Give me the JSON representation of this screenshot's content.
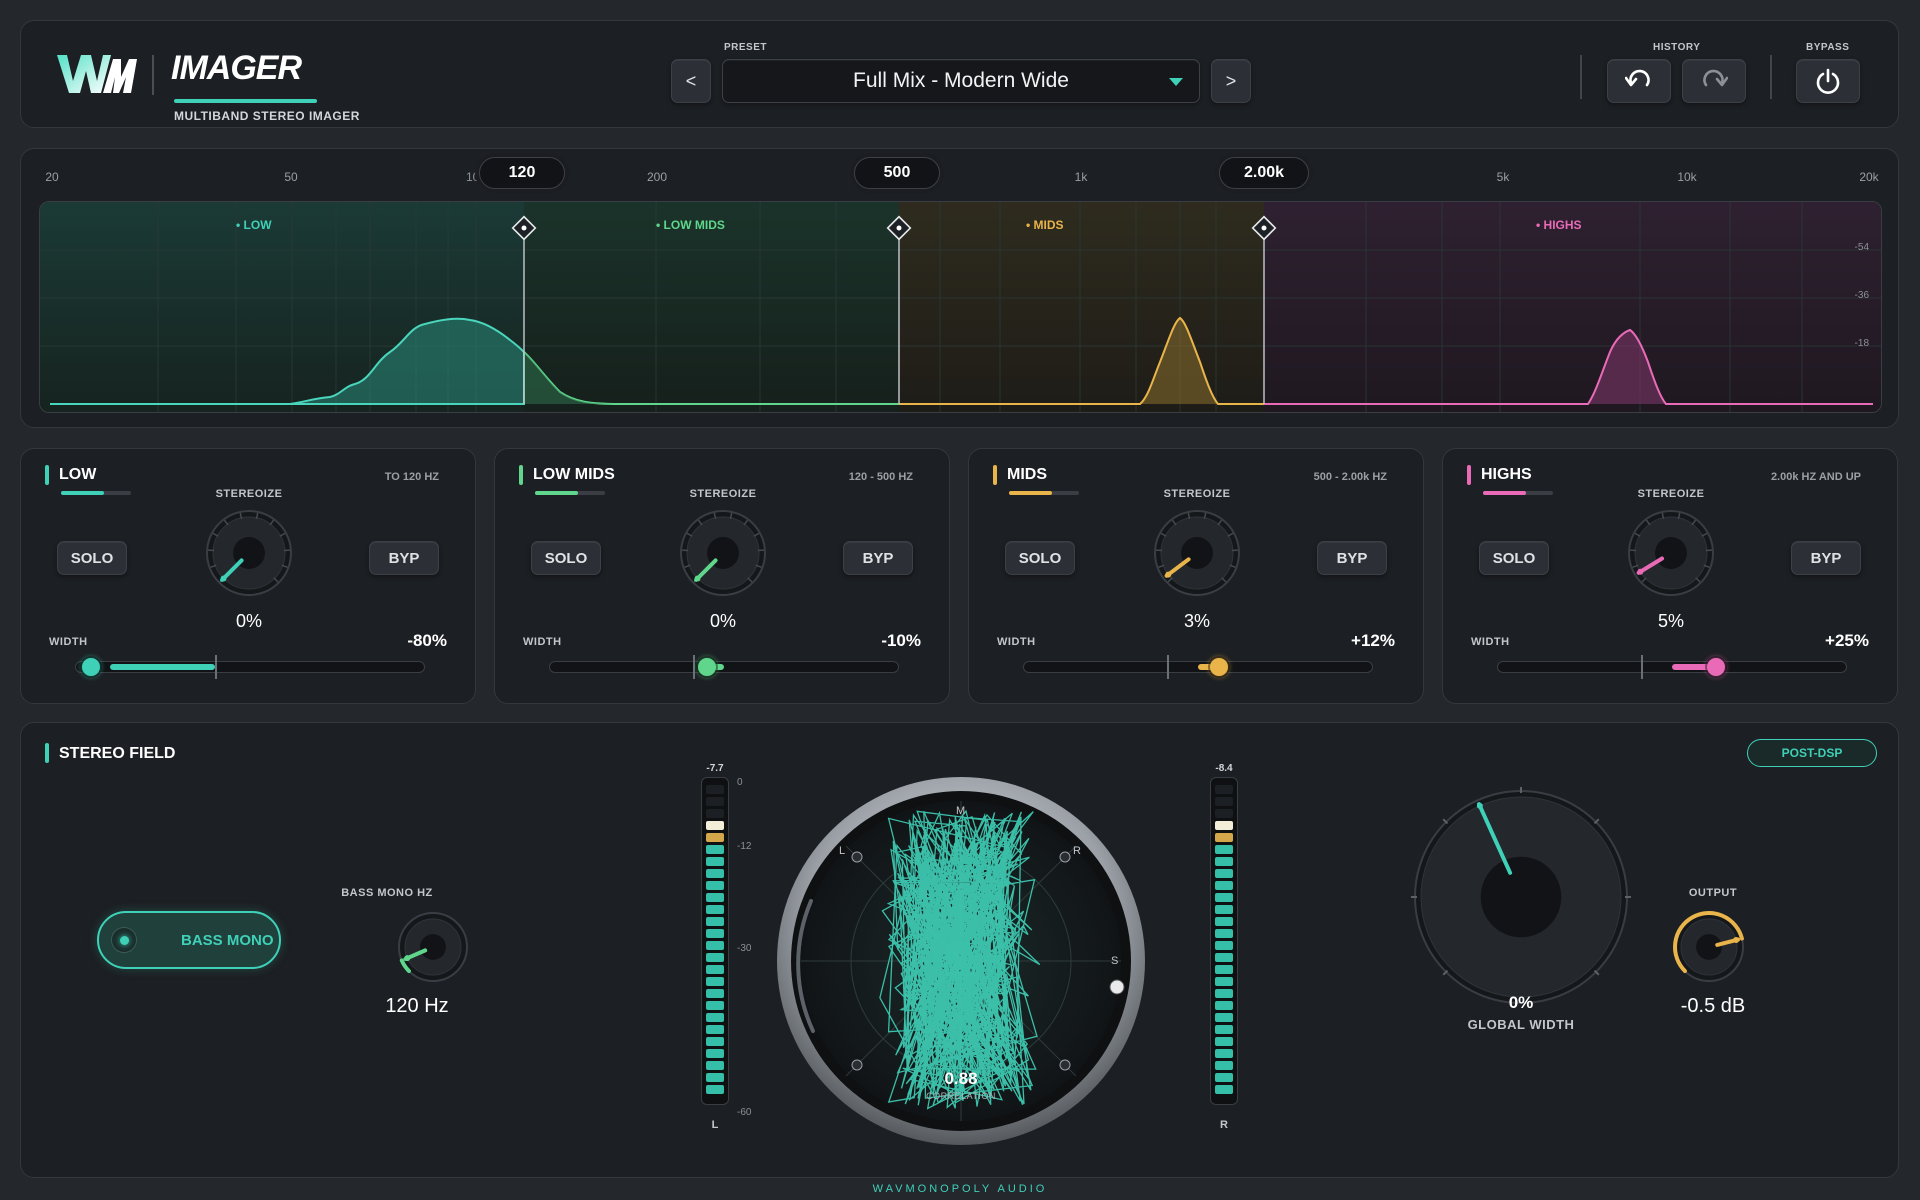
{
  "header": {
    "logo_text": "WM",
    "title": "IMAGER",
    "subtitle": "MULTIBAND STEREO IMAGER",
    "preset_label": "PRESET",
    "preset_value": "Full Mix - Modern Wide",
    "prev_label": "<",
    "next_label": ">",
    "history_label": "HISTORY",
    "bypass_label": "BYPASS"
  },
  "spectrum": {
    "freq_labels": [
      "20",
      "50",
      "100",
      "200",
      "1k",
      "5k",
      "10k",
      "20k"
    ],
    "crossovers": [
      "120",
      "500",
      "2.00k"
    ],
    "db_labels": [
      "-54",
      "-36",
      "-18"
    ],
    "band_tags": [
      "LOW",
      "LOW MIDS",
      "MIDS",
      "HIGHS"
    ]
  },
  "bands": [
    {
      "name": "LOW",
      "range": "TO 120 HZ",
      "color": "#3fd0b8",
      "stereoize_label": "STEREOIZE",
      "stereoize_value": "0%",
      "stereoize_level": 0,
      "solo": "SOLO",
      "byp": "BYP",
      "width_label": "WIDTH",
      "width_value": "-80%",
      "width_level": -0.8
    },
    {
      "name": "LOW MIDS",
      "range": "120 - 500 HZ",
      "color": "#5fd68c",
      "stereoize_label": "STEREOIZE",
      "stereoize_value": "0%",
      "stereoize_level": 0,
      "solo": "SOLO",
      "byp": "BYP",
      "width_label": "WIDTH",
      "width_value": "-10%",
      "width_level": -0.1
    },
    {
      "name": "MIDS",
      "range": "500 - 2.00k HZ",
      "color": "#e9b44a",
      "stereoize_label": "STEREOIZE",
      "stereoize_value": "3%",
      "stereoize_level": 0.03,
      "solo": "SOLO",
      "byp": "BYP",
      "width_label": "WIDTH",
      "width_value": "+12%",
      "width_level": 0.12
    },
    {
      "name": "HIGHS",
      "range": "2.00k HZ AND UP",
      "color": "#e96bb8",
      "stereoize_label": "STEREOIZE",
      "stereoize_value": "5%",
      "stereoize_level": 0.05,
      "solo": "SOLO",
      "byp": "BYP",
      "width_label": "WIDTH",
      "width_value": "+25%",
      "width_level": 0.25
    }
  ],
  "stereo": {
    "title": "STEREO FIELD",
    "post_dsp": "POST-DSP",
    "bass_mono": "BASS MONO",
    "bass_mono_hz_label": "BASS MONO HZ",
    "bass_mono_hz_value": "120 Hz",
    "meter_left_peak": "-7.7",
    "meter_right_peak": "-8.4",
    "meter_scale": [
      "0",
      "-12",
      "-30",
      "-60"
    ],
    "meter_left_label": "L",
    "meter_right_label": "R",
    "scope_labels": [
      "M",
      "L",
      "R",
      "S"
    ],
    "correlation_value": "0.88",
    "correlation_label": "CORRELATION",
    "global_width_value": "0%",
    "global_width_label": "GLOBAL WIDTH",
    "output_label": "OUTPUT",
    "output_value": "-0.5 dB"
  },
  "footer": "WAVMONOPOLY AUDIO"
}
